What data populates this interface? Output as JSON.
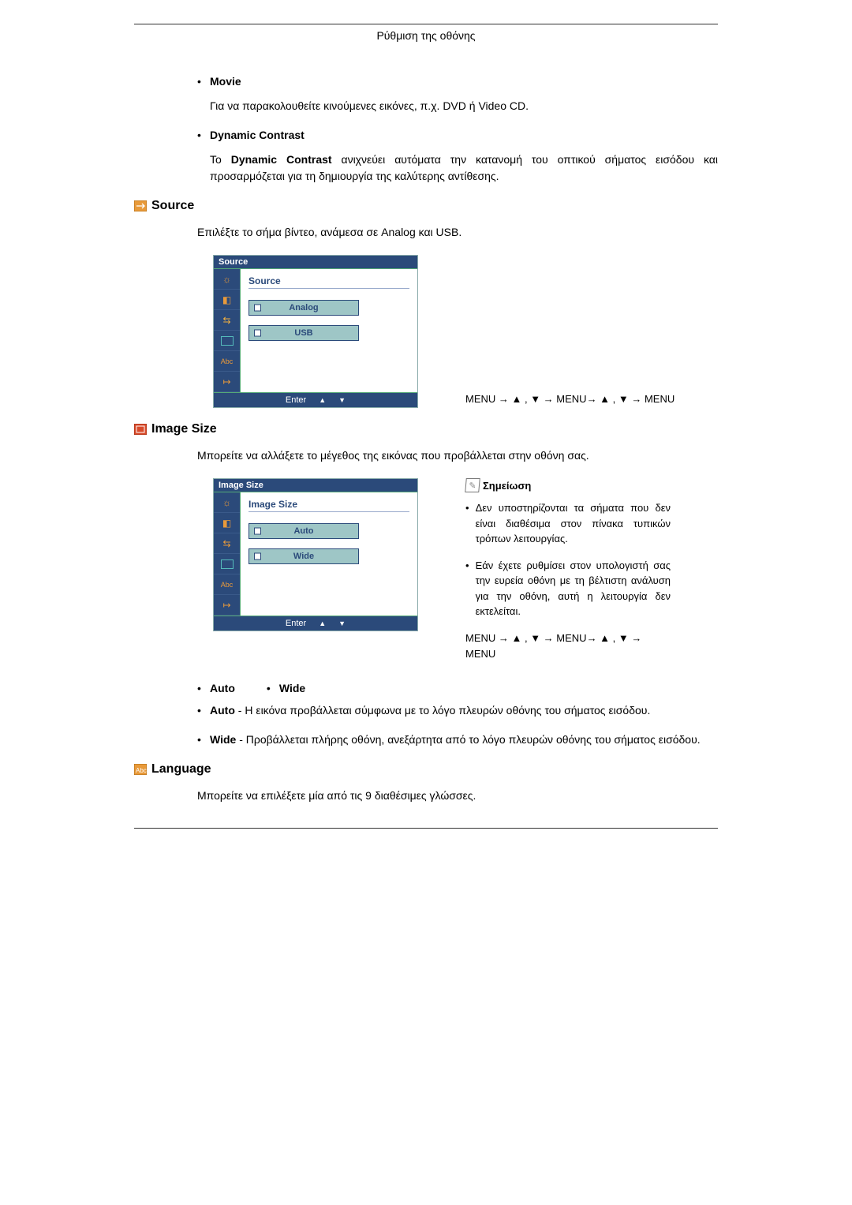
{
  "header": {
    "title": "Ρύθμιση της οθόνης"
  },
  "movie": {
    "label": "Movie",
    "desc": "Για να παρακολουθείτε κινούμενες εικόνες, π.χ. DVD ή Video CD."
  },
  "dynamic": {
    "label": "Dynamic Contrast",
    "desc_prefix": "Το ",
    "desc_bold": "Dynamic Contrast",
    "desc_suffix": " ανιχνεύει αυτόματα την κατανομή του οπτικού σήματος εισόδου και προσαρμόζεται για τη δημιουργία της καλύτερης αντίθεσης."
  },
  "source": {
    "heading": "Source",
    "intro": "Επιλέξτε το σήμα βίντεο, ανάμεσα σε Analog και USB.",
    "osd": {
      "top": "Source",
      "title": "Source",
      "opt1": "Analog",
      "opt2": "USB",
      "enter": "Enter"
    },
    "nav": "MENU → ▲ , ▼ → MENU→ ▲ , ▼ → MENU"
  },
  "image_size": {
    "heading": "Image Size",
    "intro": "Μπορείτε να αλλάξετε το μέγεθος της εικόνας που προβάλλεται στην οθόνη σας.",
    "osd": {
      "top": "Image Size",
      "title": "Image Size",
      "opt1": "Auto",
      "opt2": "Wide",
      "enter": "Enter"
    },
    "note_label": "Σημείωση",
    "note1": "Δεν υποστηρίζονται τα σήματα που δεν είναι διαθέσιμα στον πίνακα τυπικών τρόπων λειτουργίας.",
    "note2": "Εάν έχετε ρυθμίσει στον υπολογιστή σας την ευρεία οθόνη με τη βέλτιστη ανάλυση για την οθόνη, αυτή η λειτουργία δεν εκτελείται.",
    "nav": "MENU → ▲ , ▼ → MENU→ ▲ , ▼ → MENU",
    "b1": "Auto",
    "b2": "Wide",
    "auto_bold": "Auto",
    "auto_desc": " - Η εικόνα προβάλλεται σύμφωνα με το λόγο πλευρών οθόνης του σήματος εισόδου.",
    "wide_bold": "Wide",
    "wide_desc": " - Προβάλλεται πλήρης οθόνη, ανεξάρτητα από το λόγο πλευρών οθόνης του σήματος εισόδου."
  },
  "language": {
    "heading": "Language",
    "intro": "Μπορείτε να επιλέξετε μία από τις 9 διαθέσιμες γλώσσες."
  },
  "icons": {
    "source_color": "#e08a2a",
    "image_color": "#d03a2a",
    "lang_color": "#e08a2a"
  }
}
